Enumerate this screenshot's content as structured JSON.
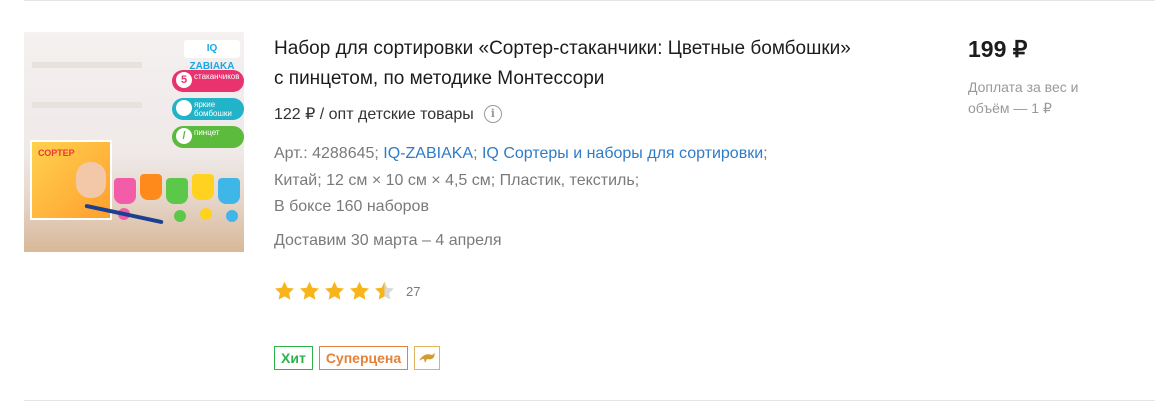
{
  "product": {
    "title": "Набор для сортировки «Сортер-стаканчики: Цветные бомбошки» с пинцетом, по методике Монтессори",
    "wholesale_price": "122 ₽ / опт детские товары",
    "info_icon_name": "info-icon",
    "specs": {
      "article": "Арт.: 4288645",
      "sep1": "; ",
      "brand_link": "IQ-ZABIAKA",
      "sep2": "; ",
      "category_link": "IQ Сортеры и наборы для сортировки",
      "sep3": ";",
      "line2": "Китай; 12 см × 10 см × 4,5 см; Пластик, текстиль;",
      "line3": "В боксе 160 наборов"
    },
    "delivery": "Доставим 30 марта – 4 апреля",
    "rating": {
      "value": 4.5,
      "max": 5,
      "reviews": "27",
      "star_color": "#f7b519",
      "empty_color": "#d9d9d9"
    },
    "labels": {
      "hit": "Хит",
      "superprice": "Суперцена",
      "promo_icon": "dolphin-icon"
    },
    "price": "199 ₽",
    "surcharge": "Доплата за вес и объём — 1 ₽",
    "image": {
      "brand": "IQ ZABIAKA",
      "badge1_num": "5",
      "badge1_text": "стаканчиков",
      "badge2_text": "яркие бомбошки",
      "badge3_text": "пинцет",
      "box_title": "СОРТЕР"
    }
  },
  "colors": {
    "link": "#2f7bc7",
    "hit": "#2cb24a",
    "superprice": "#e3823b",
    "muted": "#7a7a7a"
  }
}
